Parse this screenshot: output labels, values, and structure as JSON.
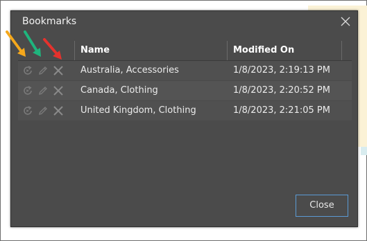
{
  "dialog": {
    "title": "Bookmarks",
    "close_button_label": "Close"
  },
  "table": {
    "columns": [
      "Name",
      "Modified On"
    ],
    "rows": [
      {
        "name": "Australia, Accessories",
        "modified_on": "1/8/2023, 2:19:13 PM"
      },
      {
        "name": "Canada, Clothing",
        "modified_on": "1/8/2023, 2:20:52 PM"
      },
      {
        "name": "United Kingdom, Clothing",
        "modified_on": "1/8/2023, 2:21:05 PM"
      }
    ],
    "row_actions": [
      "restore-icon",
      "pencil-icon",
      "delete-x-icon"
    ]
  },
  "annotation_arrows": [
    {
      "color": "#f5a81c",
      "points_to": "restore-icon"
    },
    {
      "color": "#1fb57d",
      "points_to": "pencil-icon"
    },
    {
      "color": "#e5322d",
      "points_to": "delete-x-icon"
    }
  ],
  "colors": {
    "dialog_bg": "#4b4b4b",
    "button_border": "#5b9bd5",
    "header_text": "#ffffff"
  }
}
